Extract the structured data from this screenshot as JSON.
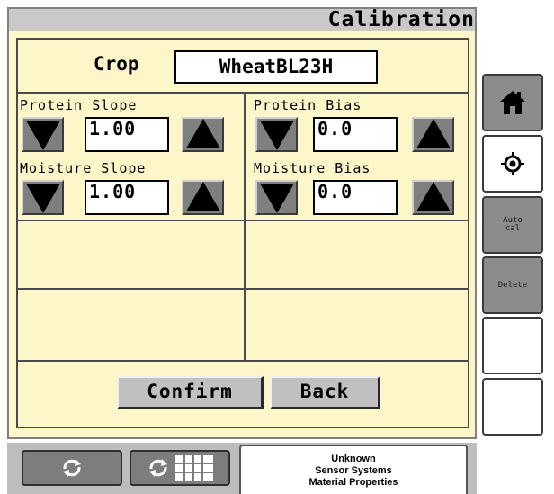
{
  "screen": {
    "title": "Calibration"
  },
  "crop": {
    "label": "Crop",
    "value": "WheatBL23H"
  },
  "params": {
    "protein_slope": {
      "label": "Protein Slope",
      "value": "1.00"
    },
    "protein_bias": {
      "label": "Protein Bias",
      "value": "0.0"
    },
    "moisture_slope": {
      "label": "Moisture Slope",
      "value": "1.00"
    },
    "moisture_bias": {
      "label": "Moisture Bias",
      "value": "0.0"
    }
  },
  "actions": {
    "confirm": "Confirm",
    "back": "Back"
  },
  "side": {
    "home_icon": "home-icon",
    "target_icon": "crosshair-icon",
    "auto_cal_line1": "Auto",
    "auto_cal_line2": "cal",
    "delete": "Delete"
  },
  "bottom": {
    "tab_line1": "Unknown",
    "tab_line2": "Sensor Systems",
    "tab_line3": "Material Properties",
    "refresh_icon": "refresh-icon",
    "grid_icon": "grid-icon"
  },
  "colors": {
    "panel_bg": "#fdf6c9",
    "button_grey": "#7f7f7f"
  }
}
